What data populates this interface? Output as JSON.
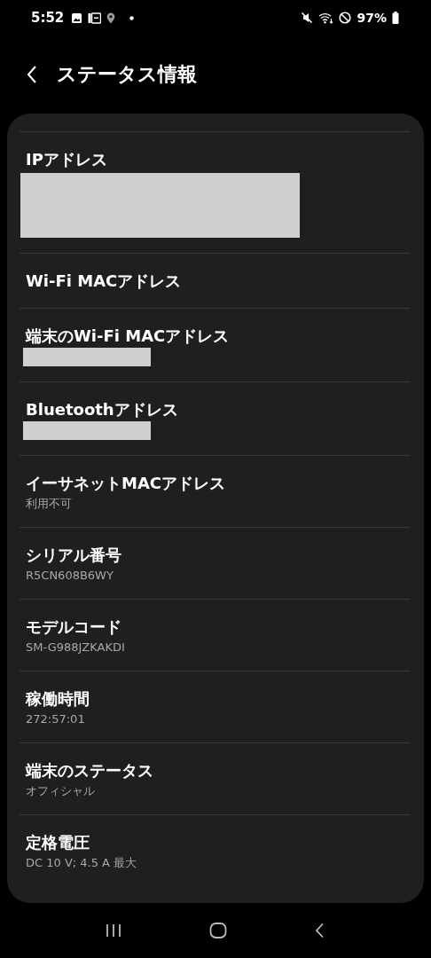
{
  "status_bar": {
    "time": "5:52",
    "battery": "97%"
  },
  "header": {
    "title": "ステータス情報"
  },
  "items": [
    {
      "kind": "masked",
      "label": "IPアドレス"
    },
    {
      "kind": "plain",
      "label": "Wi-Fi MACアドレス"
    },
    {
      "kind": "masked_short",
      "label": "端末のWi-Fi MACアドレス"
    },
    {
      "kind": "masked_short",
      "label": "Bluetoothアドレス"
    },
    {
      "kind": "plain",
      "label": "イーサネットMACアドレス",
      "value": "利用不可"
    },
    {
      "kind": "plain",
      "label": "シリアル番号",
      "value": "R5CN608B6WY"
    },
    {
      "kind": "plain",
      "label": "モデルコード",
      "value": "SM-G988JZKAKDI"
    },
    {
      "kind": "plain",
      "label": "稼働時間",
      "value": "272:57:01"
    },
    {
      "kind": "plain",
      "label": "端末のステータス",
      "value": "オフィシャル"
    },
    {
      "kind": "plain",
      "label": "定格電圧",
      "value": "DC 10 V; 4.5 A 最大"
    }
  ]
}
